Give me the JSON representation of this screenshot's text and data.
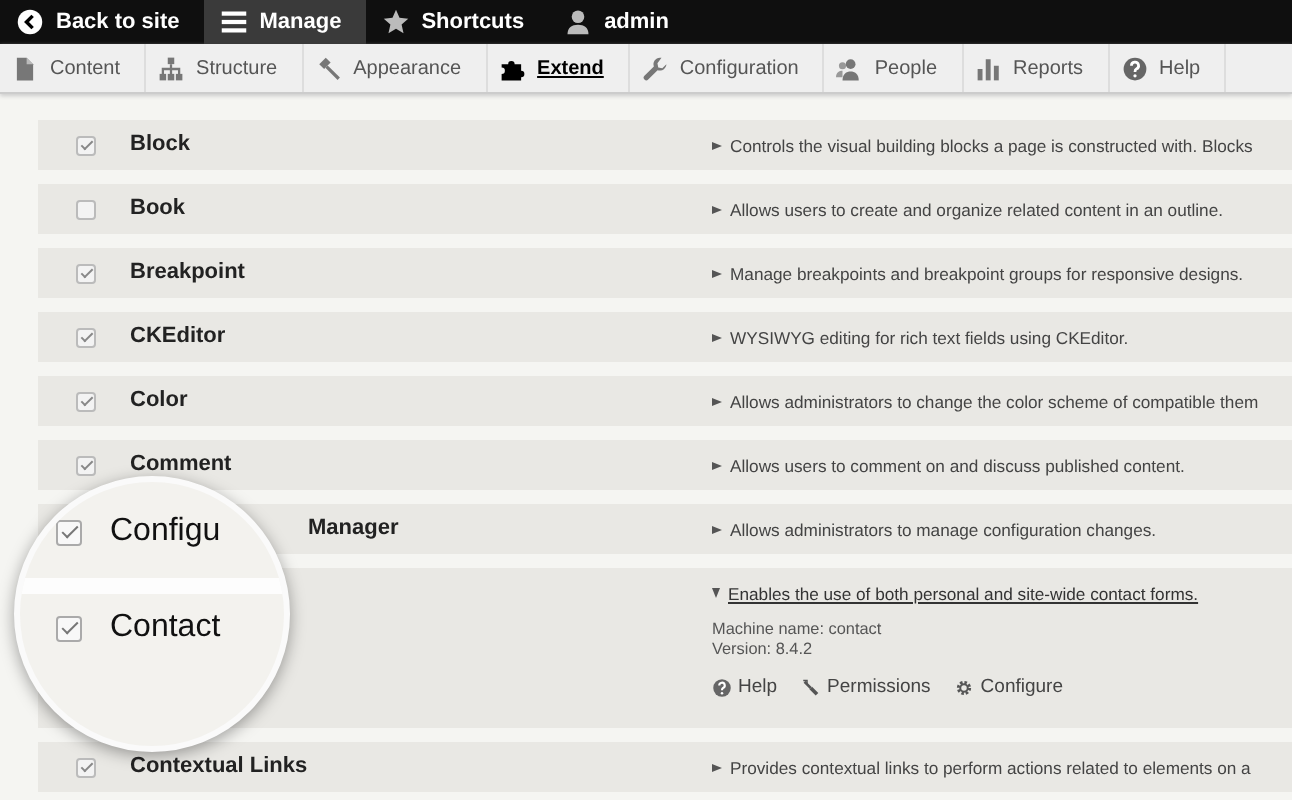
{
  "toolbar": {
    "items": [
      {
        "label": "Back to site",
        "selected": false
      },
      {
        "label": "Manage",
        "selected": true
      },
      {
        "label": "Shortcuts",
        "selected": false
      },
      {
        "label": "admin",
        "selected": false
      }
    ]
  },
  "tray": {
    "items": [
      {
        "label": "Content",
        "selected": false
      },
      {
        "label": "Structure",
        "selected": false
      },
      {
        "label": "Appearance",
        "selected": false
      },
      {
        "label": "Extend",
        "selected": true
      },
      {
        "label": "Configuration",
        "selected": false
      },
      {
        "label": "People",
        "selected": false
      },
      {
        "label": "Reports",
        "selected": false
      },
      {
        "label": "Help",
        "selected": false
      }
    ]
  },
  "modules": [
    {
      "kind": "module",
      "name": "Block",
      "checked": true,
      "expanded": false,
      "description": "Controls the visual building blocks a page is constructed with. Blocks"
    },
    {
      "kind": "module",
      "name": "Book",
      "checked": false,
      "expanded": false,
      "description": "Allows users to create and organize related content in an outline."
    },
    {
      "kind": "module",
      "name": "Breakpoint",
      "checked": true,
      "expanded": false,
      "description": "Manage breakpoints and breakpoint groups for responsive designs."
    },
    {
      "kind": "module",
      "name": "CKEditor",
      "checked": true,
      "expanded": false,
      "description": "WYSIWYG editing for rich text fields using CKEditor."
    },
    {
      "kind": "module",
      "name": "Color",
      "checked": true,
      "expanded": false,
      "description": "Allows administrators to change the color scheme of compatible them"
    },
    {
      "kind": "module",
      "name": "Comment",
      "checked": true,
      "expanded": false,
      "description": "Allows users to comment on and discuss published content."
    },
    {
      "kind": "under-lens",
      "name": "Manager",
      "expanded": false,
      "description": "Allows administrators to manage configuration changes."
    },
    {
      "kind": "under-lens",
      "expanded": true,
      "description": "Enables the use of both personal and site-wide contact forms.",
      "machine_name": "Machine name: contact",
      "version": "Version: 8.4.2",
      "actions": [
        {
          "label": "Help"
        },
        {
          "label": "Permissions"
        },
        {
          "label": "Configure"
        }
      ]
    },
    {
      "kind": "module",
      "name": "Contextual Links",
      "checked": true,
      "expanded": false,
      "description": "Provides contextual links to perform actions related to elements on a"
    }
  ],
  "magnifier": {
    "items": [
      {
        "label": "Configu",
        "checked": true
      },
      {
        "label": "Contact",
        "checked": true
      }
    ]
  }
}
